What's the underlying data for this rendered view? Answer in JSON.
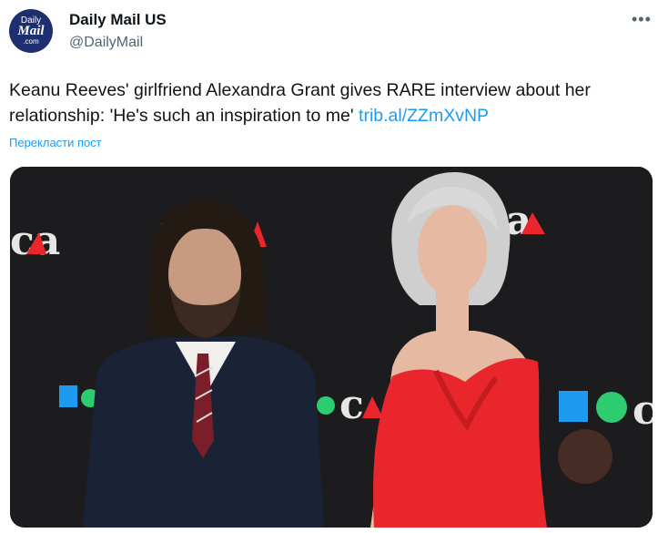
{
  "account": {
    "avatar_line1": "Daily",
    "avatar_line2": "Mail",
    "avatar_line3": ".com",
    "display_name": "Daily Mail US",
    "handle": "@DailyMail"
  },
  "menu": {
    "more_label": "•••"
  },
  "tweet": {
    "text": "Keanu Reeves' girlfriend Alexandra Grant gives RARE interview about her relationship: 'He's such an inspiration to me' ",
    "link_text": "trib.al/ZZmXvNP",
    "translate_label": "Перекласти пост"
  },
  "media": {
    "backdrop_text_1": "ca",
    "backdrop_text_2": "ca",
    "backdrop_text_3": "c",
    "colors": {
      "backdrop": "#1c1c1e",
      "dress": "#e8262b",
      "suit": "#1a2335",
      "link": "#1d9bf0"
    }
  }
}
